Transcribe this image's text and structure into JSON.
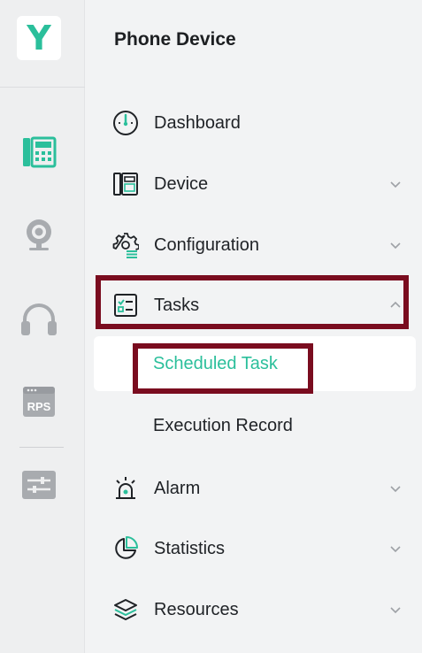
{
  "app": {
    "logo_letter": "Y",
    "accent_color": "#2bbf9b",
    "highlight_color": "#7a0c1f"
  },
  "rail": {
    "items": [
      {
        "icon": "phone-device-icon",
        "active": true
      },
      {
        "icon": "webcam-icon",
        "active": false
      },
      {
        "icon": "headset-icon",
        "active": false
      },
      {
        "icon": "rps-icon",
        "label": "RPS",
        "active": false
      },
      {
        "icon": "settings-sliders-icon",
        "active": false
      }
    ]
  },
  "panel": {
    "title": "Phone Device",
    "menu": [
      {
        "label": "Dashboard",
        "icon": "dashboard-gauge-icon",
        "expandable": false
      },
      {
        "label": "Device",
        "icon": "desk-phone-icon",
        "expandable": true,
        "expanded": false
      },
      {
        "label": "Configuration",
        "icon": "gear-config-icon",
        "expandable": true,
        "expanded": false
      },
      {
        "label": "Tasks",
        "icon": "task-checklist-icon",
        "expandable": true,
        "expanded": true,
        "children": [
          {
            "label": "Scheduled Task",
            "active": true
          },
          {
            "label": "Execution Record",
            "active": false
          }
        ]
      },
      {
        "label": "Alarm",
        "icon": "alarm-siren-icon",
        "expandable": true,
        "expanded": false
      },
      {
        "label": "Statistics",
        "icon": "pie-chart-icon",
        "expandable": true,
        "expanded": false
      },
      {
        "label": "Resources",
        "icon": "layers-icon",
        "expandable": true,
        "expanded": false
      }
    ]
  }
}
